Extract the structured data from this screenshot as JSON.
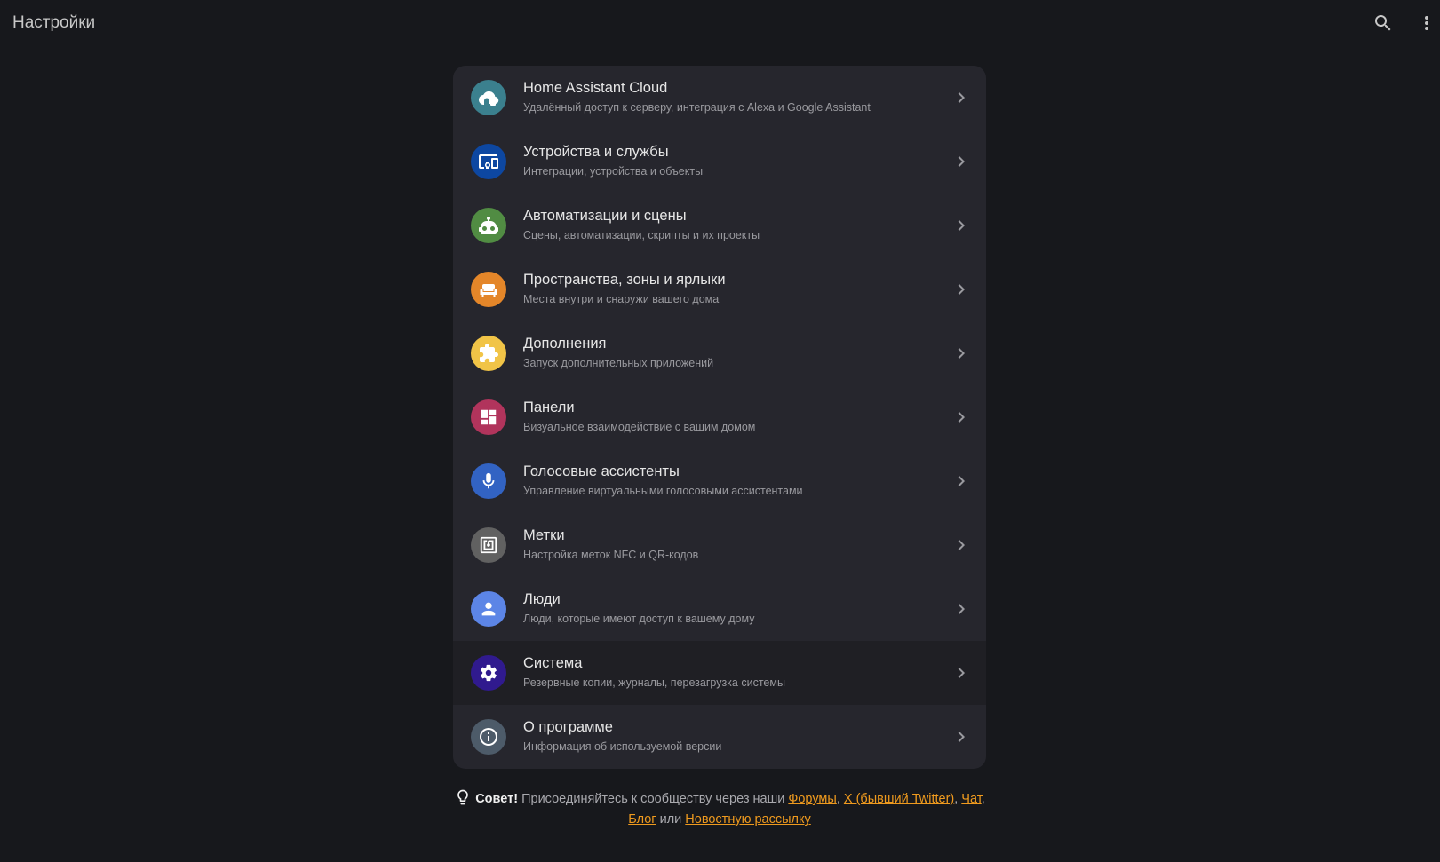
{
  "header": {
    "title": "Настройки",
    "search_icon": "search-icon",
    "menu_icon": "dots-vertical-icon"
  },
  "menu": {
    "items": [
      {
        "title": "Home Assistant Cloud",
        "subtitle": "Удалённый доступ к серверу, интеграция с Alexa и Google Assistant",
        "icon": "cloud-lock-icon",
        "color": "#3b808e"
      },
      {
        "title": "Устройства и службы",
        "subtitle": "Интеграции, устройства и объекты",
        "icon": "devices-icon",
        "color": "#0d47a1"
      },
      {
        "title": "Автоматизации и сцены",
        "subtitle": "Сцены, автоматизации, скрипты и их проекты",
        "icon": "robot-icon",
        "color": "#518c43"
      },
      {
        "title": "Пространства, зоны и ярлыки",
        "subtitle": "Места внутри и снаружи вашего дома",
        "icon": "sofa-icon",
        "color": "#e48629"
      },
      {
        "title": "Дополнения",
        "subtitle": "Запуск дополнительных приложений",
        "icon": "puzzle-icon",
        "color": "#f1c447"
      },
      {
        "title": "Панели",
        "subtitle": "Визуальное взаимодействие с вашим домом",
        "icon": "dashboard-icon",
        "color": "#b1345c"
      },
      {
        "title": "Голосовые ассистенты",
        "subtitle": "Управление виртуальными голосовыми ассистентами",
        "icon": "microphone-icon",
        "color": "#3263c3"
      },
      {
        "title": "Метки",
        "subtitle": "Настройка меток NFC и QR-кодов",
        "icon": "nfc-tag-icon",
        "color": "#616161"
      },
      {
        "title": "Люди",
        "subtitle": "Люди, которые имеют доступ к вашему дому",
        "icon": "account-icon",
        "color": "#5c85e6"
      },
      {
        "title": "Система",
        "subtitle": "Резервные копии, журналы, перезагрузка системы",
        "icon": "cog-icon",
        "color": "#301a8e"
      },
      {
        "title": "О программе",
        "subtitle": "Информация об используемой версии",
        "icon": "information-icon",
        "color": "#4d5b69"
      }
    ]
  },
  "tip": {
    "label": "Совет!",
    "text": "Присоединяйтесь к сообществу через наши",
    "links": [
      "Форумы",
      "X (бывший Twitter)",
      "Чат",
      "Блог",
      "Новостную рассылку"
    ],
    "sep": ",",
    "or": "или",
    "link_color": "#ef9a1e"
  }
}
